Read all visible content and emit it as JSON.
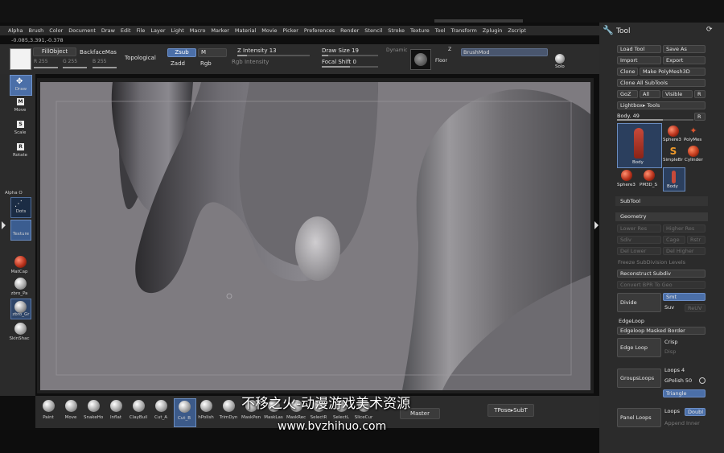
{
  "menu": [
    "Alpha",
    "Brush",
    "Color",
    "Document",
    "Draw",
    "Edit",
    "File",
    "Layer",
    "Light",
    "Macro",
    "Marker",
    "Material",
    "Movie",
    "Picker",
    "Preferences",
    "Render",
    "Stencil",
    "Stroke",
    "Texture",
    "Tool",
    "Transform",
    "Zplugin",
    "Zscript"
  ],
  "coords": "-0.085,3.391,-0.378",
  "top": {
    "fill_object": "FillObject",
    "backface": "BackfaceMas",
    "topological": "Topological",
    "r_label": "R 255",
    "g_label": "G 255",
    "b_label": "B 255",
    "zsub": "Zsub",
    "m": "M",
    "zadd": "Zadd",
    "rgb": "Rgb",
    "z_intensity": "Z Intensity 13",
    "rgb_intensity": "Rgb Intensity",
    "draw_size": "Draw Size 19",
    "focal_shift": "Focal Shift 0",
    "dynamic": "Dynamic",
    "floor": "Floor",
    "brush_mod": "BrushMod",
    "solo": "Solo",
    "xyz": "Z"
  },
  "left_tools": [
    {
      "label": "Draw"
    },
    {
      "label": "Move"
    },
    {
      "label": "Scale"
    },
    {
      "label": "Rotate"
    }
  ],
  "left_lower": {
    "alpha": "Alpha O",
    "dots": "Dots",
    "texture": "Texture",
    "matcap": "MatCap",
    "zbro_pa": "zbro_Pa",
    "zbro_gr": "zbro_Gr",
    "skinshade": "SkinShac"
  },
  "right": {
    "title": "Tool",
    "buttons": [
      "Load Tool",
      "Save As",
      "Import",
      "Export",
      "Clone",
      "Make PolyMesh3D",
      "Clone All SubTools",
      "GoZ",
      "All",
      "Visible",
      "R"
    ],
    "lightbox": "Lightbox▸ Tools",
    "body_label": "Body. 49",
    "r_btn": "R",
    "thumbs": [
      "Body",
      "Sphere3",
      "PolyMes",
      "SimpleBr",
      "Cylinder",
      "Sphere3",
      "PM3D_S",
      "Body"
    ],
    "subtool": "SubTool",
    "geometry": "Geometry",
    "dim_rows": [
      "Lower Res",
      "Higher Res",
      "Sdiv",
      "Cage",
      "Rstr",
      "Del Lower",
      "Del Higher",
      "Freeze SubDivision Levels"
    ],
    "reconstruct": "Reconstruct Subdiv",
    "convert": "Convert BPR To Geo",
    "divide": "Divide",
    "smt": "Smt",
    "suv": "Suv",
    "reuv": "ReUV",
    "edgeloop": "EdgeLoop",
    "edgeloop_masked": "Edgeloop Masked Border",
    "edge_loop": "Edge Loop",
    "crisp": "Crisp",
    "disp": "Disp",
    "groupsloops": "GroupsLoops",
    "loops": "Loops 4",
    "gpolish": "GPolish 50",
    "triangle": "Triangle",
    "panel_loops": "Panel Loops",
    "loops2": "Loops",
    "double": "Doubl",
    "append_inner": "Append Inner"
  },
  "bottom": {
    "brushes": [
      "Paint",
      "Move",
      "SnakeHo",
      "Inflat",
      "ClayBuil",
      "Cut_A",
      "Cut_B",
      "hPolish",
      "TrimDyn",
      "MaskPen",
      "MaskLas",
      "MaskRec",
      "SelectR",
      "SelectL",
      "SliceCur"
    ],
    "master": "Master",
    "tpose": "TPose▸SubT"
  },
  "watermark": {
    "line1": "不移之火-动漫游戏美术资源",
    "line2": "www.byzhihuo.com"
  }
}
